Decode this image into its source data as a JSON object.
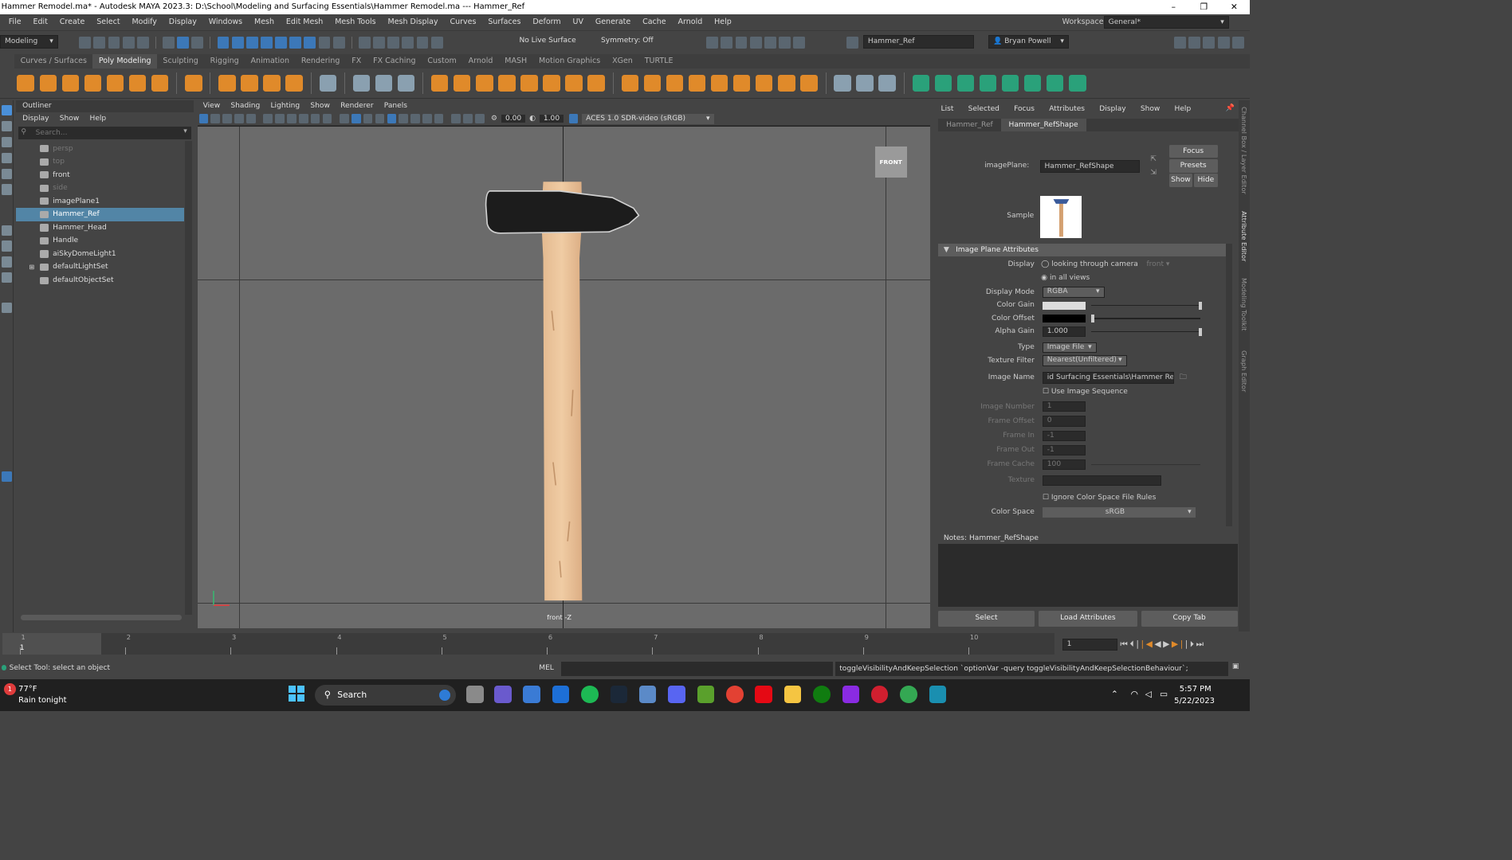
{
  "window": {
    "title": "Hammer Remodel.ma* - Autodesk MAYA 2023.3: D:\\School\\Modeling and Surfacing Essentials\\Hammer Remodel.ma   ---   Hammer_Ref",
    "minimize": "–",
    "maximize": "❐",
    "close": "✕"
  },
  "menu": [
    "File",
    "Edit",
    "Create",
    "Select",
    "Modify",
    "Display",
    "Windows",
    "Mesh",
    "Edit Mesh",
    "Mesh Tools",
    "Mesh Display",
    "Curves",
    "Surfaces",
    "Deform",
    "UV",
    "Generate",
    "Cache",
    "Arnold",
    "Help"
  ],
  "workspace": {
    "label": "Workspace:",
    "value": "General*"
  },
  "status": {
    "mode": "Modeling",
    "live_surface": "No Live Surface",
    "symmetry": "Symmetry: Off",
    "name_field": "Hammer_Ref",
    "user": "Bryan Powell"
  },
  "shelf_tabs": [
    "Curves / Surfaces",
    "Poly Modeling",
    "Sculpting",
    "Rigging",
    "Animation",
    "Rendering",
    "FX",
    "FX Caching",
    "Custom",
    "Arnold",
    "MASH",
    "Motion Graphics",
    "XGen",
    "TURTLE"
  ],
  "shelf_active": "Poly Modeling",
  "outliner": {
    "title": "Outliner",
    "menu": [
      "Display",
      "Show",
      "Help"
    ],
    "search_placeholder": "Search...",
    "items": [
      {
        "label": "persp",
        "icon": "camera-icon",
        "dim": true
      },
      {
        "label": "top",
        "icon": "camera-icon",
        "dim": true
      },
      {
        "label": "front",
        "icon": "camera-icon",
        "dim": false
      },
      {
        "label": "side",
        "icon": "camera-icon",
        "dim": true
      },
      {
        "label": "imagePlane1",
        "icon": "image-plane-icon",
        "dim": false
      },
      {
        "label": "Hammer_Ref",
        "icon": "image-plane-icon",
        "dim": false,
        "selected": true
      },
      {
        "label": "Hammer_Head",
        "icon": "mesh-icon",
        "dim": false
      },
      {
        "label": "Handle",
        "icon": "mesh-icon",
        "dim": false
      },
      {
        "label": "aiSkyDomeLight1",
        "icon": "light-icon",
        "dim": false
      },
      {
        "label": "defaultLightSet",
        "icon": "set-icon",
        "dim": false,
        "expandable": true
      },
      {
        "label": "defaultObjectSet",
        "icon": "set-icon",
        "dim": false
      }
    ]
  },
  "viewport": {
    "menu": [
      "View",
      "Shading",
      "Lighting",
      "Show",
      "Renderer",
      "Panels"
    ],
    "near": "0.00",
    "far": "1.00",
    "colorspace": "ACES 1.0 SDR-video (sRGB)",
    "camera_label": "front -Z",
    "viewcube": "FRONT"
  },
  "attribute_editor": {
    "menu": [
      "List",
      "Selected",
      "Focus",
      "Attributes",
      "Display",
      "Show",
      "Help"
    ],
    "tabs": [
      "Hammer_Ref",
      "Hammer_RefShape"
    ],
    "active_tab": "Hammer_RefShape",
    "image_plane_label": "imagePlane:",
    "image_plane_value": "Hammer_RefShape",
    "focus": "Focus",
    "presets": "Presets",
    "show": "Show",
    "hide": "Hide",
    "sample_label": "Sample",
    "section": "Image Plane Attributes",
    "display_label": "Display",
    "display_opt1": "looking through camera",
    "display_opt1_cam": "front",
    "display_opt2": "in all views",
    "display_mode_label": "Display Mode",
    "display_mode": "RGBA",
    "color_gain_label": "Color Gain",
    "color_offset_label": "Color Offset",
    "alpha_gain_label": "Alpha Gain",
    "alpha_gain": "1.000",
    "type_label": "Type",
    "type": "Image File",
    "texture_filter_label": "Texture Filter",
    "texture_filter": "Nearest(Unfiltered)",
    "image_name_label": "Image Name",
    "image_name": "id Surfacing Essentials\\Hammer Ref.jpg",
    "use_sequence": "Use Image Sequence",
    "image_number_label": "Image Number",
    "image_number": "1",
    "frame_offset_label": "Frame Offset",
    "frame_offset": "0",
    "frame_in_label": "Frame In",
    "frame_in": "-1",
    "frame_out_label": "Frame Out",
    "frame_out": "-1",
    "frame_cache_label": "Frame Cache",
    "frame_cache": "100",
    "texture_label": "Texture",
    "ignore_cs": "Ignore Color Space File Rules",
    "color_space_label": "Color Space",
    "color_space": "sRGB",
    "notes_label": "Notes:  Hammer_RefShape",
    "select_btn": "Select",
    "load_btn": "Load Attributes",
    "copy_btn": "Copy Tab"
  },
  "side_tabs": [
    "Channel Box / Layer Editor",
    "Attribute Editor",
    "Modeling Toolkit",
    "Graph Editor"
  ],
  "timeline": {
    "ticks": [
      "1",
      "2",
      "3",
      "4",
      "5",
      "6",
      "7",
      "8",
      "9",
      "10"
    ],
    "current": "1",
    "frame_field": "1"
  },
  "command": {
    "help": "Select Tool: select an object",
    "lang": "MEL",
    "result": "toggleVisibilityAndKeepSelection `optionVar -query toggleVisibilityAndKeepSelectionBehaviour`;"
  },
  "taskbar": {
    "weather_temp": "77°F",
    "weather_desc": "Rain tonight",
    "search": "Search",
    "time": "5:57 PM",
    "date": "5/22/2023"
  },
  "colors": {
    "selection": "#5285a6",
    "shelf_orange": "#e08a2a",
    "viewport_bg": "#6b6b6b"
  }
}
